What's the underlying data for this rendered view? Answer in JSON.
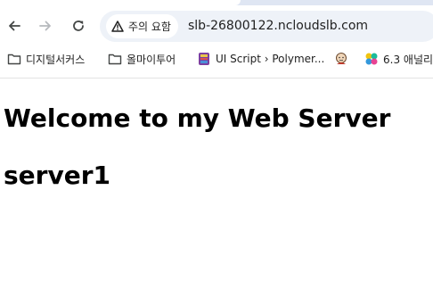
{
  "browser": {
    "security_label": "주의 요함",
    "url": "slb-26800122.ncloudslb.com",
    "nav": {
      "back_icon": "arrow-left-icon",
      "forward_icon": "arrow-right-icon",
      "reload_icon": "reload-icon"
    },
    "bookmarks": [
      {
        "label": "디지털서커스",
        "icon": "folder-icon"
      },
      {
        "label": "올마이투어",
        "icon": "folder-icon"
      },
      {
        "label": "UI Script › Polymer...",
        "icon": "polymer-favicon"
      },
      {
        "label": "",
        "icon": "jenkins-favicon"
      },
      {
        "label": "6.3 애널리",
        "icon": "elastic-favicon"
      }
    ]
  },
  "page": {
    "heading": "Welcome to my Web Server",
    "server_name": "server1"
  },
  "colors": {
    "tab_strip": "#dfe6f3",
    "omnibox_bg": "#eef2f8",
    "text": "#1f1f1f",
    "page_text": "#000000"
  }
}
